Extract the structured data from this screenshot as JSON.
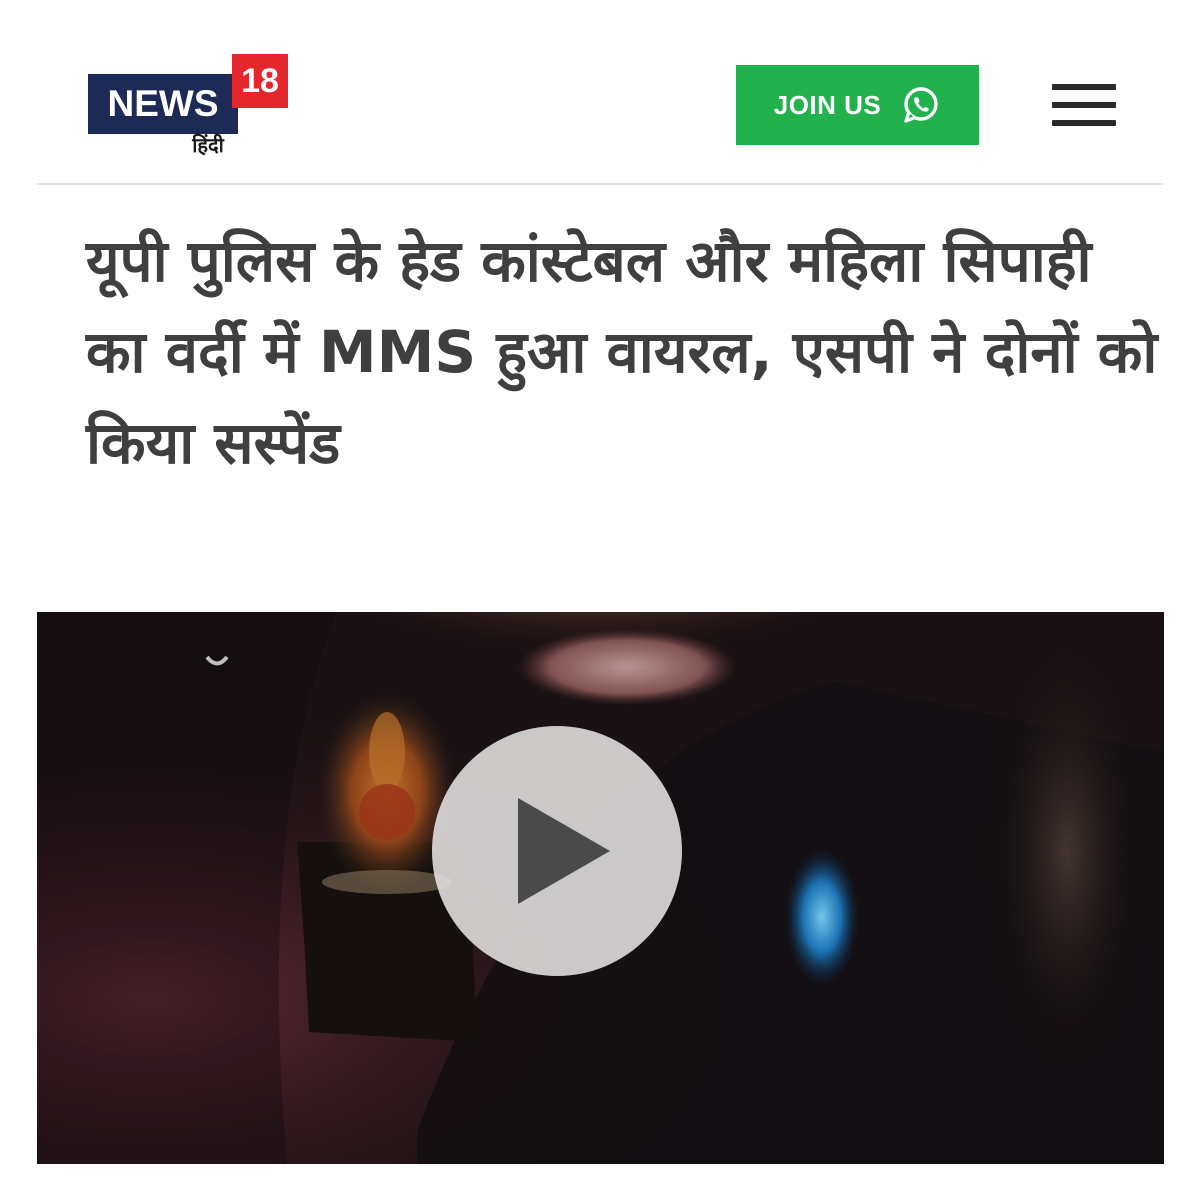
{
  "header": {
    "logo": {
      "brand": "NEWS",
      "number": "18",
      "language": "हिंदी"
    },
    "join_button": {
      "label": "JOIN US",
      "icon": "whatsapp-icon",
      "color": "#22b14c"
    },
    "menu_icon": "hamburger-menu-icon"
  },
  "article": {
    "headline": "यूपी पुलिस के हेड कांस्टेबल और महिला सिपाही का वर्दी में MMS हुआ वायरल, एसपी ने दोनों को किया सस्पेंड"
  },
  "video": {
    "play_icon": "play-icon"
  }
}
